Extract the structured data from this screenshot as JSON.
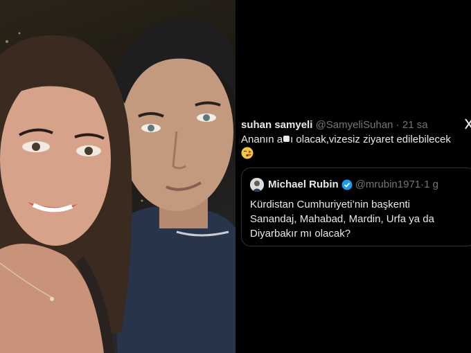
{
  "tweet": {
    "display_name": "suhan samyeli",
    "handle": "@SamyeliSuhan",
    "separator": "·",
    "time": "21 sa",
    "text_part1": "Ananın a",
    "text_part2": "ı olacak,vizesiz ziyaret edilebilecek",
    "emoji": "kissing-face-emoji",
    "more_icon": "more-icon"
  },
  "quoted_tweet": {
    "display_name": "Michael Rubin",
    "handle": "@mrubin1971",
    "separator": "·",
    "time": "1 g",
    "text": "Kürdistan Cumhuriyeti’nin başkenti Sanandaj, Mahabad, Mardin, Urfa ya da Diyarbakır mı olacak?",
    "badge_color": "#1d9bf0"
  },
  "colors": {
    "background": "#000000",
    "text_primary": "#e7e9ea",
    "text_secondary": "#71767b",
    "border": "#2f3336"
  }
}
